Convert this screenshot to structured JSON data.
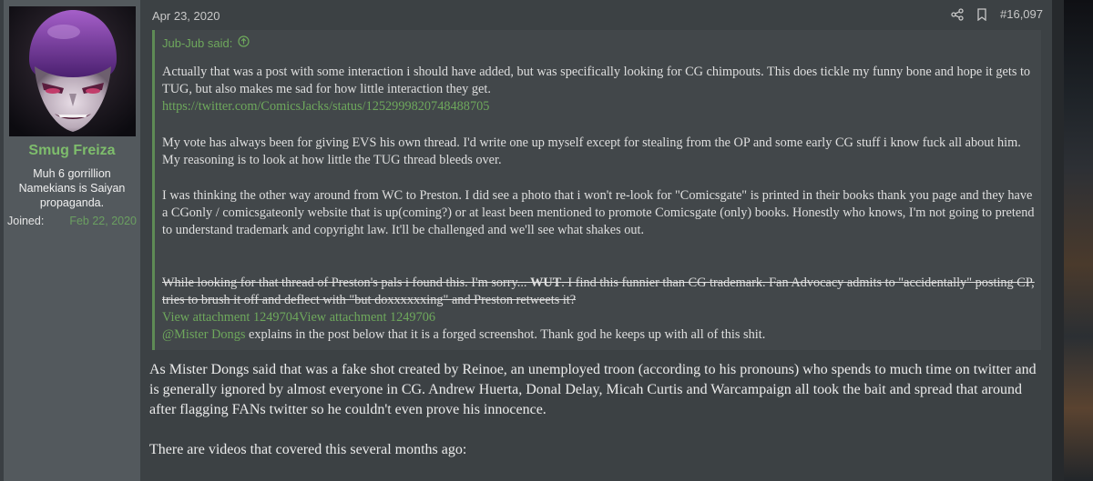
{
  "user": {
    "name": "Smug Freiza",
    "title": "Muh 6 gorrillion Namekians is Saiyan propaganda.",
    "joined_label": "Joined:",
    "joined_date": "Feb 22, 2020"
  },
  "post": {
    "date": "Apr 23, 2020",
    "number": "#16,097",
    "quote": {
      "author_label": "Jub-Jub said:",
      "p1": "Actually that was a post with some interaction i should have added, but was specifically looking for CG chimpouts. This does tickle my funny bone and hope it gets to TUG, but also makes me sad for how little interaction they get.",
      "link1": "https://twitter.com/ComicsJacks/status/1252999820748488705",
      "p2": "My vote has always been for giving EVS his own thread. I'd write one up myself except for stealing from the OP and some early CG stuff i know fuck all about him. My reasoning is to look at how little the TUG thread bleeds over.",
      "p3": "I was thinking the other way around from WC to Preston. I did see a photo that i won't re-look for \"Comicsgate\" is printed in their books thank you page and they have a CGonly / comicsgateonly website that is up(coming?) or at least been mentioned to promote Comicsgate (only) books. Honestly who knows, I'm not going to pretend to understand trademark and copyright law. It'll be challenged and we'll see what shakes out.",
      "strike_a": "While looking for that thread of Preston's pals i found this. I'm sorry... ",
      "strike_bold": "WUT",
      "strike_b": ". I find this funnier than CG trademark. Fan Advocacy admits to \"accidentally\" posting CP, tries to brush it off and deflect with \"but doxxxxxxing\" and Preston retweets it?",
      "attachments": "View attachment 1249704View attachment 1249706",
      "mention": "@Mister Dongs",
      "mention_rest": " explains in the post below that it is a forged screenshot. Thank god he keeps up with all of this shit."
    },
    "reply_p1": "As Mister Dongs said that was a fake shot created by Reinoe, an unemployed troon (according to his pronouns) who spends to much time on twitter and is generally ignored by almost everyone in CG. Andrew Huerta, Donal Delay, Micah Curtis and Warcampaign all took the bait and spread that around after flagging FANs twitter so he couldn't even prove his innocence.",
    "reply_p2": "There are videos that covered this several months ago:"
  },
  "icons": [
    "share-icon",
    "bookmark-icon",
    "quote-jump-icon"
  ],
  "colors": {
    "accent_green": "#6ea85c",
    "username_green": "#7ebd6c",
    "panel_bg": "#53595d",
    "content_bg": "#3c4144"
  }
}
